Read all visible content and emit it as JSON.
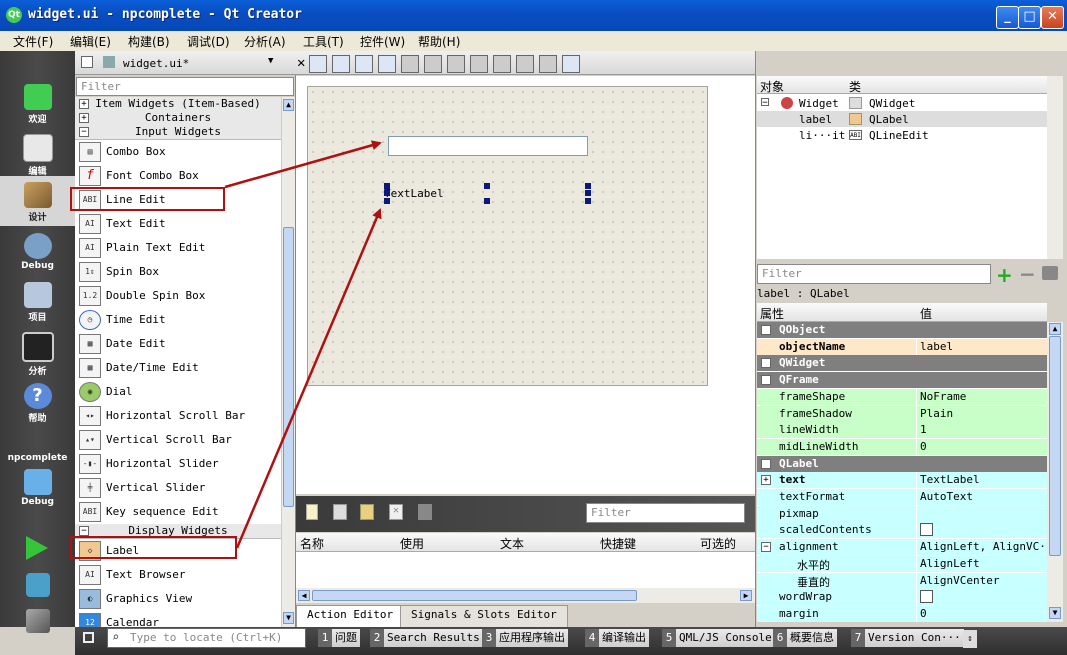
{
  "window": {
    "title": "widget.ui - npcomplete - Qt Creator",
    "minimize": "_",
    "maximize": "□",
    "close": "✕"
  },
  "menu": [
    "文件(F)",
    "编辑(E)",
    "构建(B)",
    "调试(D)",
    "分析(A)",
    "工具(T)",
    "控件(W)",
    "帮助(H)"
  ],
  "modes": [
    {
      "label": "欢迎",
      "icon": "qt-logo-icon"
    },
    {
      "label": "编辑",
      "icon": "document-icon"
    },
    {
      "label": "设计",
      "icon": "pencil-icon"
    },
    {
      "label": "Debug",
      "icon": "bug-icon"
    },
    {
      "label": "项目",
      "icon": "wrench-icon"
    },
    {
      "label": "分析",
      "icon": "monitor-icon"
    },
    {
      "label": "帮助",
      "icon": "help-icon"
    }
  ],
  "project": {
    "name": "npcomplete",
    "build": "Debug"
  },
  "editor": {
    "file": "widget.ui*"
  },
  "widgetbox": {
    "filter_placeholder": "Filter",
    "categories": [
      "Item Widgets (Item-Based)",
      "Containers",
      "Input Widgets",
      "Display Widgets"
    ],
    "input_widgets": [
      "Combo Box",
      "Font Combo Box",
      "Line Edit",
      "Text Edit",
      "Plain Text Edit",
      "Spin Box",
      "Double Spin Box",
      "Time Edit",
      "Date Edit",
      "Date/Time Edit",
      "Dial",
      "Horizontal Scroll Bar",
      "Vertical Scroll Bar",
      "Horizontal Slider",
      "Vertical Slider",
      "Key sequence Edit"
    ],
    "display_widgets": [
      "Label",
      "Text Browser",
      "Graphics View",
      "Calendar"
    ]
  },
  "form": {
    "label_text": "TextLabel"
  },
  "action_editor": {
    "filter_placeholder": "Filter",
    "columns": [
      "名称",
      "使用",
      "文本",
      "快捷键",
      "可选的"
    ],
    "tabs": [
      "Action Editor",
      "Signals & Slots Editor"
    ]
  },
  "object_inspector": {
    "columns": [
      "对象",
      "类"
    ],
    "rows": [
      {
        "object": "Widget",
        "class": "QWidget"
      },
      {
        "object": "label",
        "class": "QLabel"
      },
      {
        "object": "li···it",
        "class": "QLineEdit"
      }
    ]
  },
  "property_editor": {
    "filter_placeholder": "Filter",
    "selection": "label : QLabel",
    "columns": [
      "属性",
      "值"
    ],
    "rows": [
      {
        "type": "class",
        "name": "QObject"
      },
      {
        "type": "obj",
        "name": "objectName",
        "value": "label",
        "bold": true
      },
      {
        "type": "class",
        "name": "QWidget"
      },
      {
        "type": "class",
        "name": "QFrame"
      },
      {
        "type": "frame",
        "name": "frameShape",
        "value": "NoFrame"
      },
      {
        "type": "frame",
        "name": "frameShadow",
        "value": "Plain"
      },
      {
        "type": "frame",
        "name": "lineWidth",
        "value": "1"
      },
      {
        "type": "frame",
        "name": "midLineWidth",
        "value": "0"
      },
      {
        "type": "class",
        "name": "QLabel"
      },
      {
        "type": "lbl",
        "name": "text",
        "value": "TextLabel",
        "bold": true
      },
      {
        "type": "lbl",
        "name": "textFormat",
        "value": "AutoText"
      },
      {
        "type": "lbl",
        "name": "pixmap",
        "value": ""
      },
      {
        "type": "lbl",
        "name": "scaledContents",
        "value": "[ ]"
      },
      {
        "type": "lbl",
        "name": "alignment",
        "value": "AlignLeft, AlignVC···"
      },
      {
        "type": "lbl",
        "name": "水平的",
        "value": "AlignLeft"
      },
      {
        "type": "lbl",
        "name": "垂直的",
        "value": "AlignVCenter"
      },
      {
        "type": "lbl",
        "name": "wordWrap",
        "value": "[ ]"
      },
      {
        "type": "lbl",
        "name": "margin",
        "value": "0"
      }
    ]
  },
  "statusbar": {
    "locator_placeholder": "Type to locate (Ctrl+K)",
    "tabs": [
      {
        "n": "1",
        "label": "问题"
      },
      {
        "n": "2",
        "label": "Search Results"
      },
      {
        "n": "3",
        "label": "应用程序输出"
      },
      {
        "n": "4",
        "label": "编译输出"
      },
      {
        "n": "5",
        "label": "QML/JS Console"
      },
      {
        "n": "6",
        "label": "概要信息"
      },
      {
        "n": "7",
        "label": "Version Con···"
      }
    ]
  },
  "colors": {
    "annotation_arrow": "#b01010",
    "selection_handle": "#0b1a7a"
  }
}
